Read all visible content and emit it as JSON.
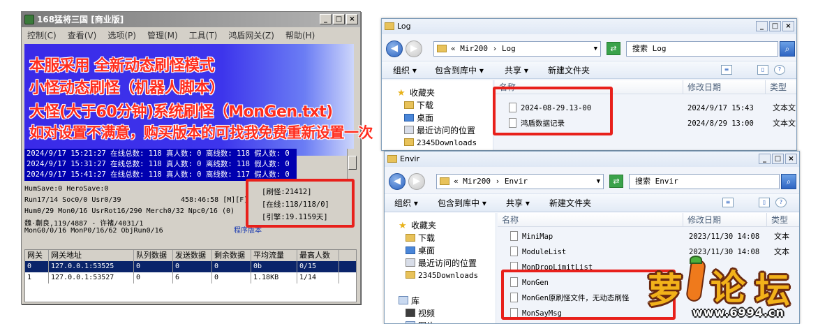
{
  "server_window": {
    "title": "168猛将三国 [商业版]",
    "menu": [
      "控制(C)",
      "查看(V)",
      "选项(P)",
      "管理(M)",
      "工具(T)",
      "鸿盾网关(Z)",
      "帮助(H)"
    ],
    "log_lines": [
      "2024/9/17 15:21:27 在线总数: 118 真人数: 0 离线数: 118 假人数: 0",
      "2024/9/17 15:31:27 在线总数: 118 真人数: 0 离线数: 118 假人数: 0",
      "2024/9/17 15:41:27 在线总数: 118 真人数: 0 离线数: 117 假人数: 0"
    ],
    "status": {
      "line1": "HumSave:0 HeroSave:0",
      "line2": "Run17/14 Soc0/0 Usr0/39",
      "time": "458:46:58 [M][F]",
      "line3": "Hum0/29 Mon0/16 UsrRot16/290 Merch0/32 Npc0/16 (0)",
      "line4": "魏·蒯良,119/4887 - 许褚/4031/1",
      "line5": "MonG0/0/16 MonP0/16/62 ObjRun0/16",
      "version": "程序版本"
    },
    "counters": {
      "spawn": "[刷怪:21412]",
      "online": "[在线:118/118/0]",
      "engine": "[引擎:19.1159天]"
    },
    "gateway_table": {
      "columns": [
        "网关",
        "网关地址",
        "队列数据",
        "发送数据",
        "剩余数据",
        "平均流量",
        "最高人数"
      ],
      "rows": [
        [
          "0",
          "127.0.0.1:53525",
          "0",
          "0",
          "0",
          "0b",
          "0/15"
        ],
        [
          "1",
          "127.0.0.1:53527",
          "0",
          "6",
          "0",
          "1.18KB",
          "1/14"
        ]
      ]
    }
  },
  "overlay_text": [
    "本服采用 全新动态刷怪模式",
    "小怪动态刷怪（机器人脚本）",
    "大怪(大于60分钟)系统刷怪（MonGen.txt)",
    "如对设置不满意，购买版本的可找我免费重新设置一次"
  ],
  "log_window": {
    "title": "Log",
    "address": "« Mir200 › Log",
    "search": "搜索 Log",
    "toolbar": [
      "组织 ▾",
      "包含到库中 ▾",
      "共享 ▾",
      "新建文件夹"
    ],
    "nav": [
      "收藏夹",
      "下载",
      "桌面",
      "最近访问的位置",
      "2345Downloads"
    ],
    "columns": [
      "名称",
      "修改日期",
      "类型"
    ],
    "files": [
      {
        "name": "2024-08-29.13-00",
        "date": "2024/9/17 15:43",
        "type": "文本文"
      },
      {
        "name": "鸿盾数据记录",
        "date": "2024/8/29 13:00",
        "type": "文本文"
      }
    ]
  },
  "envir_window": {
    "title": "Envir",
    "address": "« Mir200 › Envir",
    "search": "搜索 Envir",
    "toolbar": [
      "组织 ▾",
      "包含到库中 ▾",
      "共享 ▾",
      "新建文件夹"
    ],
    "nav": [
      "收藏夹",
      "下载",
      "桌面",
      "最近访问的位置",
      "2345Downloads",
      "库",
      "视频",
      "图片"
    ],
    "columns": [
      "名称",
      "修改日期",
      "类型"
    ],
    "files": [
      {
        "name": "MiniMap",
        "date": "2023/11/30 14:08",
        "type": "文本"
      },
      {
        "name": "ModuleList",
        "date": "2023/11/30 14:08",
        "type": "文本"
      },
      {
        "name": "MonDropLimitList",
        "date": "",
        "type": ""
      },
      {
        "name": "MonGen",
        "date": "",
        "type": ""
      },
      {
        "name": "MonGen原刷怪文件，无动态刷怪",
        "date": "",
        "type": ""
      },
      {
        "name": "MonSayMsg",
        "date": "",
        "type": ""
      }
    ]
  },
  "logo": {
    "chars": [
      "萝",
      "卜",
      "论",
      "坛"
    ],
    "url": "www.6994.cn"
  },
  "colors": {
    "highlight_red": "#e8201b",
    "banner_blue": "#3a2ae8",
    "overlay_text_red": "#ff2d1e",
    "selection_navy": "#0a246a"
  }
}
